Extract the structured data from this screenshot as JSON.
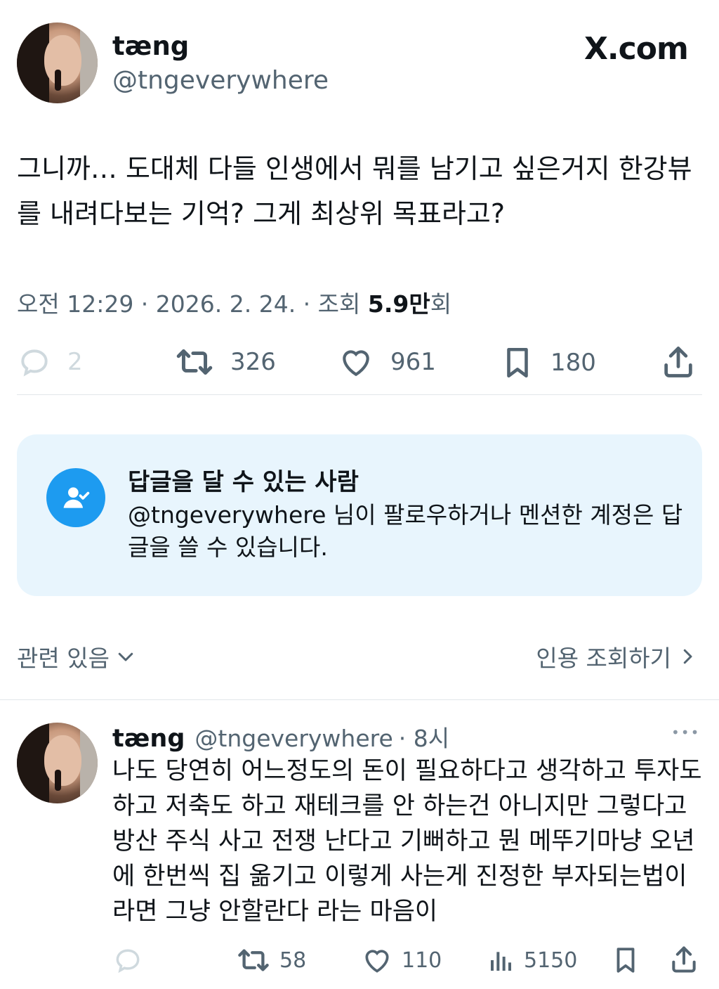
{
  "tweet": {
    "display_name": "tæng",
    "handle": "@tngeverywhere",
    "site_badge": "X.com",
    "text": "그니까… 도대체 다들 인생에서 뭐를 남기고 싶은거지 한강뷰를 내려다보는 기억? 그게 최상위 목표라고?",
    "meta": {
      "datetime": "오전 12:29 · 2026. 2. 24. · 조회 ",
      "views": "5.9만",
      "views_suffix": "회"
    },
    "actions": {
      "replies": "2",
      "retweets": "326",
      "likes": "961",
      "bookmarks": "180"
    },
    "icons": [
      "reply-icon",
      "retweet-icon",
      "like-icon",
      "bookmark-icon",
      "share-icon"
    ]
  },
  "reply_restriction": {
    "title": "답글을 달 수 있는 사람",
    "description": "@tngeverywhere 님이 팔로우하거나 멘션한 계정은 답글을 쓸 수 있습니다.",
    "icon": "person-check-icon",
    "accent_color": "#1d9bf0",
    "background_color": "#e8f5fd"
  },
  "links": {
    "relevance": "관련 있음",
    "quotes": "인용 조회하기"
  },
  "reply": {
    "display_name": "tæng",
    "handle": "@tngeverywhere",
    "time": "· 8시",
    "more": "•••",
    "text": "나도 당연히 어느정도의 돈이 필요하다고 생각하고 투자도 하고 저축도 하고 재테크를 안 하는건 아니지만 그렇다고 방산 주식 사고 전쟁 난다고 기뻐하고 뭔 메뚜기마냥 오년에 한번씩 집 옮기고 이렇게 사는게 진정한 부자되는법이라면 그냥 안할란다 라는 마음이",
    "actions": {
      "retweets": "58",
      "likes": "110",
      "views": "5150"
    }
  }
}
